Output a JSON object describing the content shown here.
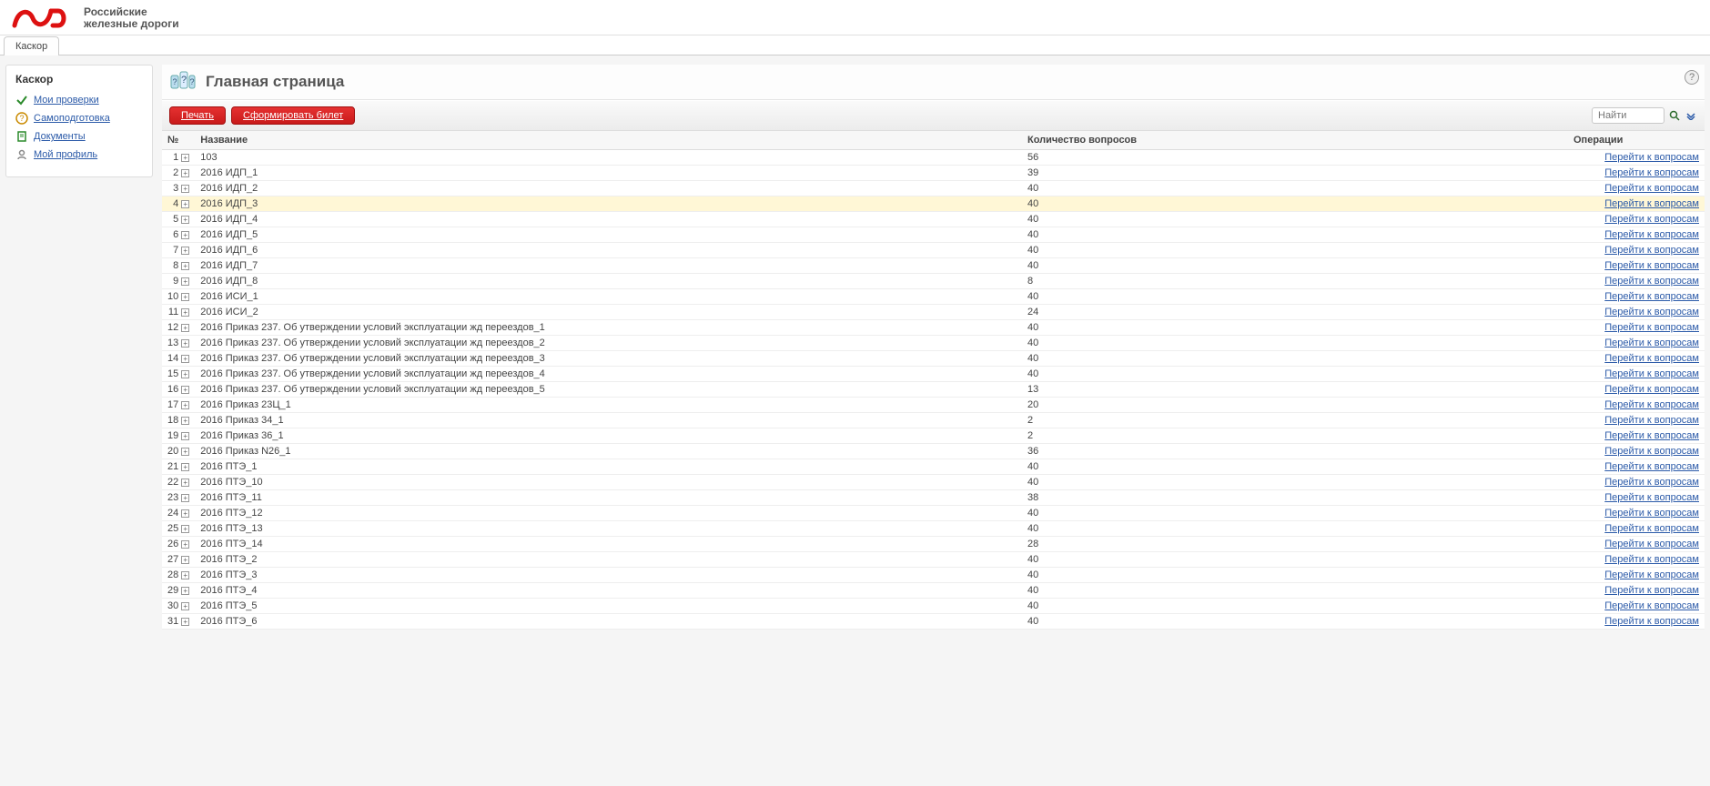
{
  "brand": {
    "line1": "Российские",
    "line2": "железные дороги"
  },
  "tab": "Каскор",
  "sidebar": {
    "title": "Каскор",
    "items": [
      {
        "label": "Мои проверки",
        "icon": "check-icon"
      },
      {
        "label": "Самоподготовка",
        "icon": "question-icon"
      },
      {
        "label": "Документы",
        "icon": "document-icon"
      },
      {
        "label": "Мой профиль",
        "icon": "profile-icon"
      }
    ]
  },
  "page": {
    "title": "Главная страница",
    "print_btn": "Печать",
    "form_ticket_btn": "Сформировать билет",
    "search_placeholder": "Найти",
    "help_symbol": "?"
  },
  "columns": {
    "num": "№",
    "name": "Название",
    "qcount": "Количество вопросов",
    "ops": "Операции"
  },
  "op_link_text": "Перейти к вопросам",
  "highlight_row": 4,
  "rows": [
    {
      "n": 1,
      "name": "103",
      "q": 56
    },
    {
      "n": 2,
      "name": "2016 ИДП_1",
      "q": 39
    },
    {
      "n": 3,
      "name": "2016 ИДП_2",
      "q": 40
    },
    {
      "n": 4,
      "name": "2016 ИДП_3",
      "q": 40
    },
    {
      "n": 5,
      "name": "2016 ИДП_4",
      "q": 40
    },
    {
      "n": 6,
      "name": "2016 ИДП_5",
      "q": 40
    },
    {
      "n": 7,
      "name": "2016 ИДП_6",
      "q": 40
    },
    {
      "n": 8,
      "name": "2016 ИДП_7",
      "q": 40
    },
    {
      "n": 9,
      "name": "2016 ИДП_8",
      "q": 8
    },
    {
      "n": 10,
      "name": "2016 ИСИ_1",
      "q": 40
    },
    {
      "n": 11,
      "name": "2016 ИСИ_2",
      "q": 24
    },
    {
      "n": 12,
      "name": "2016 Приказ 237. Об утверждении условий эксплуатации жд переездов_1",
      "q": 40
    },
    {
      "n": 13,
      "name": "2016 Приказ 237. Об утверждении условий эксплуатации жд переездов_2",
      "q": 40
    },
    {
      "n": 14,
      "name": "2016 Приказ 237. Об утверждении условий эксплуатации жд переездов_3",
      "q": 40
    },
    {
      "n": 15,
      "name": "2016 Приказ 237. Об утверждении условий эксплуатации жд переездов_4",
      "q": 40
    },
    {
      "n": 16,
      "name": "2016 Приказ 237. Об утверждении условий эксплуатации жд переездов_5",
      "q": 13
    },
    {
      "n": 17,
      "name": "2016 Приказ 23Ц_1",
      "q": 20
    },
    {
      "n": 18,
      "name": "2016 Приказ 34_1",
      "q": 2
    },
    {
      "n": 19,
      "name": "2016 Приказ 36_1",
      "q": 2
    },
    {
      "n": 20,
      "name": "2016 Приказ N26_1",
      "q": 36
    },
    {
      "n": 21,
      "name": "2016 ПТЭ_1",
      "q": 40
    },
    {
      "n": 22,
      "name": "2016 ПТЭ_10",
      "q": 40
    },
    {
      "n": 23,
      "name": "2016 ПТЭ_11",
      "q": 38
    },
    {
      "n": 24,
      "name": "2016 ПТЭ_12",
      "q": 40
    },
    {
      "n": 25,
      "name": "2016 ПТЭ_13",
      "q": 40
    },
    {
      "n": 26,
      "name": "2016 ПТЭ_14",
      "q": 28
    },
    {
      "n": 27,
      "name": "2016 ПТЭ_2",
      "q": 40
    },
    {
      "n": 28,
      "name": "2016 ПТЭ_3",
      "q": 40
    },
    {
      "n": 29,
      "name": "2016 ПТЭ_4",
      "q": 40
    },
    {
      "n": 30,
      "name": "2016 ПТЭ_5",
      "q": 40
    },
    {
      "n": 31,
      "name": "2016 ПТЭ_6",
      "q": 40
    }
  ]
}
